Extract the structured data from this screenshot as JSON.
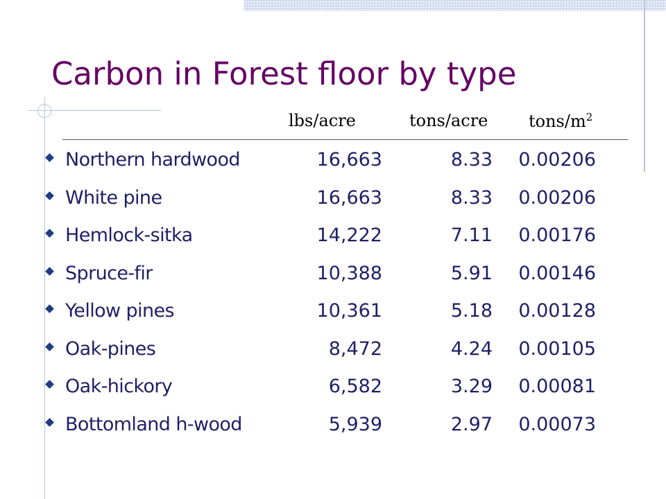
{
  "slide": {
    "title": "Carbon in Forest floor by type",
    "units": {
      "lbs": "lbs/acre",
      "tons": "tons/acre",
      "m2_base": "tons/m",
      "m2_sup": "2"
    },
    "rows": [
      {
        "name": "Northern hardwood",
        "lbs": "16,663",
        "tons": "8.33",
        "m2": "0.00206"
      },
      {
        "name": "White pine",
        "lbs": "16,663",
        "tons": "8.33",
        "m2": "0.00206"
      },
      {
        "name": "Hemlock-sitka",
        "lbs": "14,222",
        "tons": "7.11",
        "m2": "0.00176"
      },
      {
        "name": "Spruce-fir",
        "lbs": "10,388",
        "tons": "5.91",
        "m2": "0.00146"
      },
      {
        "name": "Yellow pines",
        "lbs": "10,361",
        "tons": "5.18",
        "m2": "0.00128"
      },
      {
        "name": "Oak-pines",
        "lbs": "8,472",
        "tons": "4.24",
        "m2": "0.00105"
      },
      {
        "name": "Oak-hickory",
        "lbs": "6,582",
        "tons": "3.29",
        "m2": "0.00081"
      },
      {
        "name": "Bottomland h-wood",
        "lbs": "5,939",
        "tons": "2.97",
        "m2": "0.00073"
      }
    ]
  },
  "colors": {
    "title": "#660066",
    "body_text": "#1f1f66",
    "bullet": "#1f3c82",
    "decor": "#b9c3de"
  },
  "icons": {
    "bullet": "diamond-bullet-icon",
    "corner": "corner-circle-icon"
  }
}
